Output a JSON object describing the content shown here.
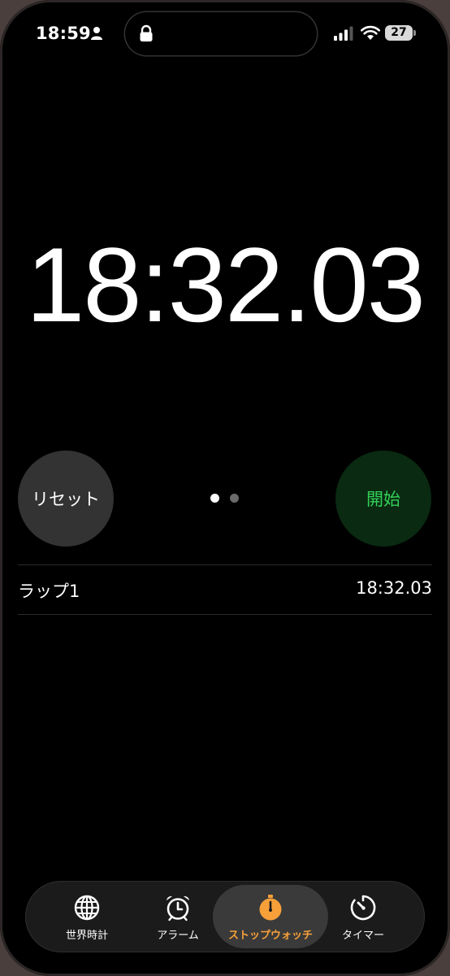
{
  "status_bar": {
    "time": "18:59",
    "battery": "27"
  },
  "stopwatch": {
    "display_time": "18:32.03"
  },
  "controls": {
    "reset_label": "リセット",
    "start_label": "開始",
    "reset_color": "#333333",
    "start_color": "#0a2a12",
    "start_text_color": "#33d158"
  },
  "laps": [
    {
      "label": "ラップ1",
      "time": "18:32.03"
    }
  ],
  "tab_bar": {
    "tabs": [
      {
        "label": "世界時計",
        "icon": "globe-icon",
        "active": false
      },
      {
        "label": "アラーム",
        "icon": "alarm-clock-icon",
        "active": false
      },
      {
        "label": "ストップウォッチ",
        "icon": "stopwatch-icon",
        "active": true
      },
      {
        "label": "タイマー",
        "icon": "timer-icon",
        "active": false
      }
    ],
    "accent_color": "#f7a03a"
  }
}
